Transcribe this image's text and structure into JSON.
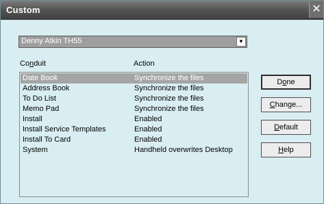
{
  "window": {
    "title": "Custom",
    "close_glyph": "✕"
  },
  "handheld_select": {
    "value": "Denny Atkin TH55",
    "arrow_glyph": "▼"
  },
  "columns": {
    "conduit": {
      "prefix": "Co",
      "accel": "n",
      "suffix": "duit"
    },
    "action": "Action"
  },
  "conduits": [
    {
      "conduit": "Date Book",
      "action": "Synchronize the files",
      "selected": true
    },
    {
      "conduit": "Address Book",
      "action": "Synchronize the files"
    },
    {
      "conduit": "To Do List",
      "action": "Synchronize the files"
    },
    {
      "conduit": "Memo Pad",
      "action": "Synchronize the files"
    },
    {
      "conduit": "Install",
      "action": "Enabled"
    },
    {
      "conduit": "Install Service Templates",
      "action": "Enabled"
    },
    {
      "conduit": "Install To Card",
      "action": "Enabled"
    },
    {
      "conduit": "System",
      "action": "Handheld overwrites Desktop"
    }
  ],
  "buttons": {
    "done": {
      "prefix": "D",
      "accel": "o",
      "suffix": "ne"
    },
    "change": {
      "prefix": "",
      "accel": "C",
      "suffix": "hange..."
    },
    "default": {
      "prefix": "",
      "accel": "D",
      "suffix": "efault"
    },
    "help": {
      "prefix": "",
      "accel": "H",
      "suffix": "elp"
    }
  },
  "colors": {
    "dialog_bg": "#d9eef2",
    "titlebar": "#555555",
    "selection": "#a5a5a5"
  }
}
